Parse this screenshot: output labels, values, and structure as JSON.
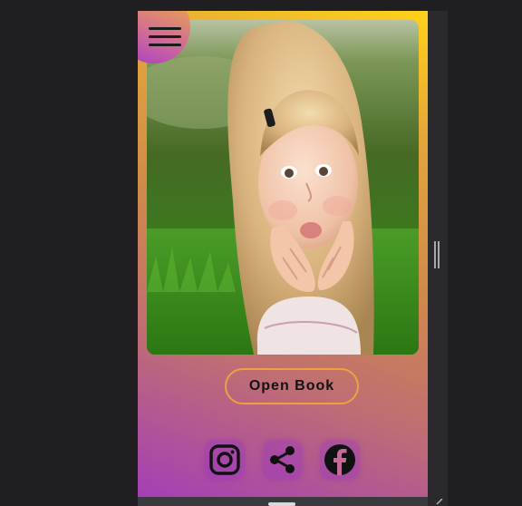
{
  "menu": {
    "icon": "hamburger-menu-icon"
  },
  "hero": {
    "subject": "child-portrait-photo"
  },
  "actions": {
    "open_book_label": "Open Book"
  },
  "social": [
    {
      "name": "instagram",
      "icon": "instagram-icon"
    },
    {
      "name": "share",
      "icon": "share-icon"
    },
    {
      "name": "facebook",
      "icon": "facebook-icon"
    }
  ],
  "colors": {
    "gradient_top": "#ffd21a",
    "gradient_bottom": "#a43fb6",
    "button_border": "#f0a13e",
    "icon": "#111111",
    "page_background": "#1f1f21"
  }
}
